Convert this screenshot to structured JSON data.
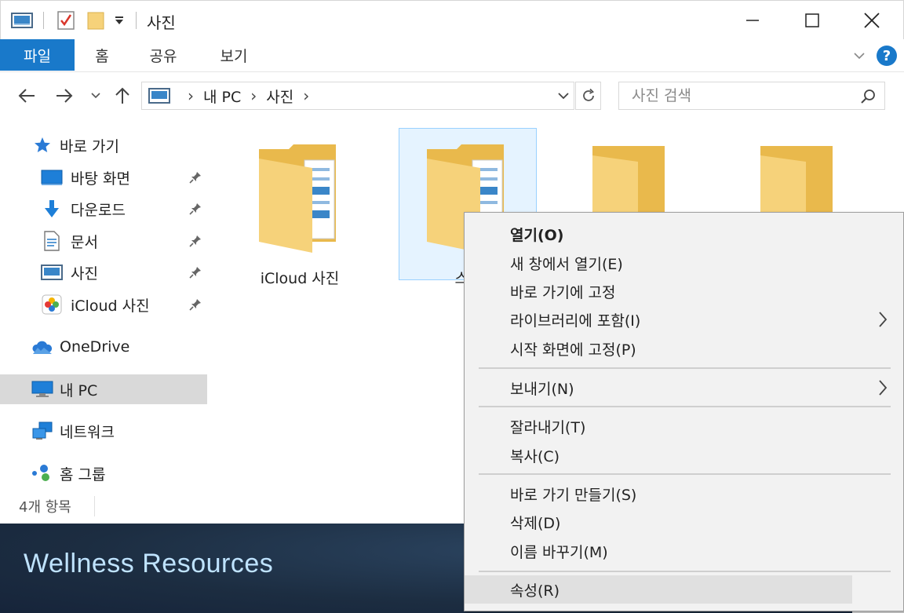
{
  "window": {
    "title": "사진"
  },
  "ribbon": {
    "tabs": [
      "파일",
      "홈",
      "공유",
      "보기"
    ],
    "help": "?"
  },
  "address": {
    "crumbs": [
      "내 PC",
      "사진"
    ],
    "search_placeholder": "사진 검색"
  },
  "sidebar": {
    "quick_access": "바로 가기",
    "pinned": [
      "바탕 화면",
      "다운로드",
      "문서",
      "사진",
      "iCloud 사진"
    ],
    "onedrive": "OneDrive",
    "this_pc": "내 PC",
    "network": "네트워크",
    "homegroup": "홈 그룹"
  },
  "status_bar": {
    "item_count": "4개 항목"
  },
  "content": {
    "folders": [
      "iCloud 사진",
      "스크",
      "",
      ""
    ]
  },
  "context_menu": {
    "groups": [
      [
        "열기(O)",
        "새 창에서 열기(E)",
        "바로 가기에 고정",
        "라이브러리에 포함(I)",
        "시작 화면에 고정(P)"
      ],
      [
        "보내기(N)"
      ],
      [
        "잘라내기(T)",
        "복사(C)"
      ],
      [
        "바로 가기 만들기(S)",
        "삭제(D)",
        "이름 바꾸기(M)"
      ],
      [
        "속성(R)"
      ]
    ]
  },
  "banner": {
    "title": "Wellness Resources"
  },
  "colors": {
    "accent": "#1979ca",
    "folder": "#f6d27a",
    "selection": "#e5f3ff",
    "banner_text": "#bfe3ff"
  }
}
